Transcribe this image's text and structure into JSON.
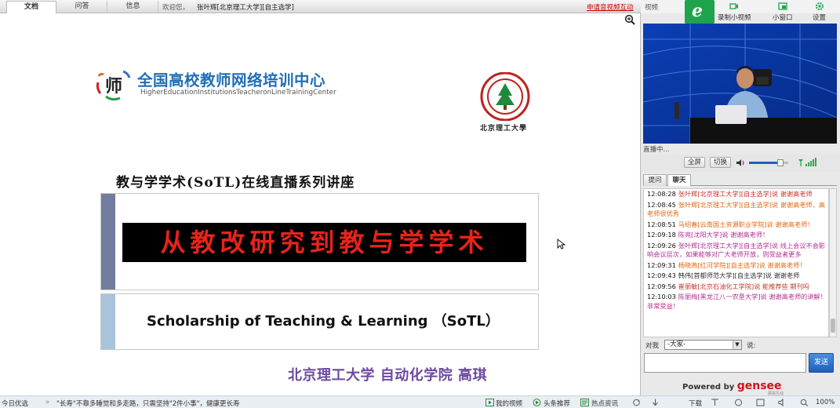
{
  "tabs": [
    {
      "label": "文档",
      "active": true
    },
    {
      "label": "问答",
      "active": false
    },
    {
      "label": "信息",
      "active": false
    }
  ],
  "welcome": {
    "prefix": "欢迎您，",
    "user": "张叶辉[北京理工大学][自主选学]"
  },
  "apply_link": "申请音视频互动",
  "slide": {
    "org_cn": "全国高校教师网络培训中心",
    "org_en": "HigherEducationInstitutionsTeacheronLineTrainingCenter",
    "seal_text": "北京理工大學",
    "series_title": "教与学学术(SoTL)在线直播系列讲座",
    "main_title": "从教改研究到教与学学术",
    "english_title": "Scholarship of Teaching & Learning （SoTL）",
    "presenter": "北京理工大学 自动化学院 高琪"
  },
  "right_panel": {
    "video_label": "视频",
    "logo_letter": "e",
    "tools": [
      {
        "label": "录制小视频",
        "icon": "video-record-icon"
      },
      {
        "label": "小窗口",
        "icon": "small-window-icon"
      },
      {
        "label": "设置",
        "icon": "gear-icon"
      }
    ],
    "status": "直播中...",
    "controls": {
      "fullscreen": "全屏",
      "switch": "切换",
      "volume_level": 0.8
    },
    "chat_tabs": [
      {
        "label": "提问",
        "active": false
      },
      {
        "label": "聊天",
        "active": true
      }
    ],
    "messages": [
      {
        "time": "12:08:28",
        "text": "张叶辉[北京理工大学][自主选学]说 谢谢高老师",
        "color": "#c0392b"
      },
      {
        "time": "12:08:45",
        "text": "张叶辉[北京理工大学][自主选学]说 谢谢高老师，高老师很优秀",
        "color": "#e06a14"
      },
      {
        "time": "12:08:51",
        "text": "马绍春[云南国土资源职业学院]说 谢谢高老师！",
        "color": "#e06a14"
      },
      {
        "time": "12:09:18",
        "text": "陈亮[沈阳大学]说 谢谢高老师！",
        "color": "#b03090"
      },
      {
        "time": "12:09:26",
        "text": "张叶辉[北京理工大学][自主选学]说 线上会议不会影响会议层次，如果能够对广大老师开放，则受益者更多",
        "color": "#b03090"
      },
      {
        "time": "12:09:31",
        "text": "杨晓燕[红河学院][自主选学]说 谢谢高老师！",
        "color": "#e06a14"
      },
      {
        "time": "12:09:43",
        "text": "韩伟[首都师范大学][自主选学]说 谢谢老师",
        "color": "#333333"
      },
      {
        "time": "12:09:56",
        "text": "崔丽敏[北京石油化工学院]说 能推荐些 期刊吗",
        "color": "#c0392b"
      },
      {
        "time": "12:10:03",
        "text": "陈丽梅[黑龙江八一农垦大学]说 谢谢高老师的讲解！非常受益！",
        "color": "#b03090"
      }
    ],
    "to_label": "对我",
    "to_select": "-大家-",
    "say_label": "说:",
    "send": "发送",
    "powered_prefix": "Powered by ",
    "powered_brand": "gensee",
    "brand_sub": "展视互动"
  },
  "statusbar": {
    "left": "今日优选",
    "news": "\"长寿\"不靠多睡觉和多走路，只需坚持\"2件小事\"，健康更长寿",
    "my_video": "我的视频",
    "headline": "头条推荐",
    "hot_news": "热点资讯",
    "download": "下载",
    "zoom": "100%"
  }
}
